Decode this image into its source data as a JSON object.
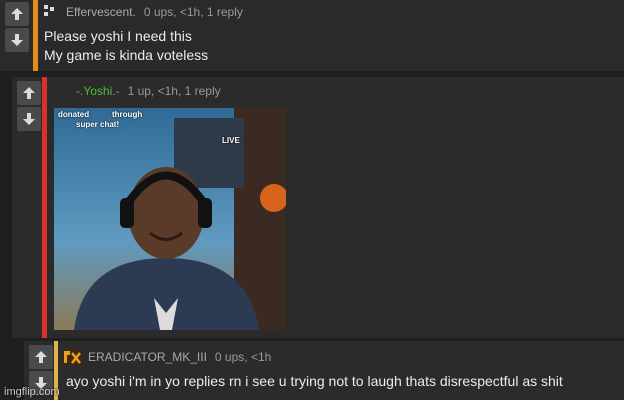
{
  "comments": [
    {
      "username": "Effervescent.",
      "meta": "0 ups, <1h, 1 reply",
      "lines": [
        "Please yoshi I need this",
        "My game is kinda voteless"
      ],
      "accent": "#e68a1a"
    },
    {
      "username": "-.Yoshi.-",
      "meta": "1 up, <1h, 1 reply",
      "accent": "#d63233",
      "image_caption": [
        "donated",
        "super chat!"
      ],
      "image_caption_partial": [
        "through",
        "LIVE"
      ],
      "image_alt": "streamer with headphones smiling"
    },
    {
      "username": "ERADICATOR_MK_III",
      "meta": "0 ups, <1h",
      "lines": [
        "ayo yoshi i'm in yo replies rn i see u trying not to laugh thats disrespectful as shit"
      ],
      "accent": "#e0b34c"
    }
  ],
  "watermark": "imgflip.com",
  "colors": {
    "background": "#1f1f1f",
    "panel": "#2a2a2a",
    "username_green": "#4fbf3a"
  }
}
